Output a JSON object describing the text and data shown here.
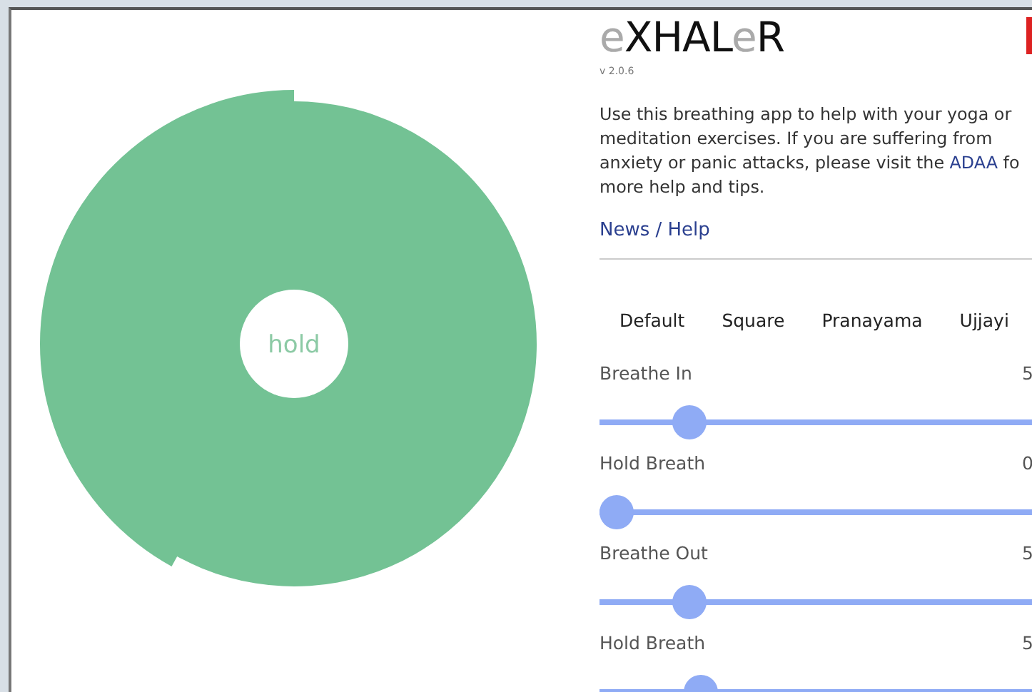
{
  "breath_circle": {
    "phase": "hold"
  },
  "title": [
    {
      "text": "e",
      "faint": true
    },
    {
      "text": "XHAL",
      "faint": false
    },
    {
      "text": "e",
      "faint": true
    },
    {
      "text": "R",
      "faint": false
    }
  ],
  "version": "v 2.0.6",
  "intro": {
    "line_1": "Use this breathing app to help with your yoga or",
    "line_2": "meditation exercises. If you are suffering from",
    "line_3": "anxiety or panic attacks, please visit the",
    "link": "ADAA",
    "line_3_end": "fo",
    "line_4": "more help and tips."
  },
  "news_link": "News / Help",
  "presets": [
    "Default",
    "Square",
    "Pranayama",
    "Ujjayi"
  ],
  "sliders": [
    {
      "label": "Breathe In",
      "value": "5",
      "level": 0.13
    },
    {
      "label": "Hold Breath",
      "value": "0",
      "level": 0
    },
    {
      "label": "Breathe Out",
      "value": "5",
      "level": 0.13
    },
    {
      "label": "Hold Breath",
      "value": "5",
      "level": 0.15
    }
  ]
}
